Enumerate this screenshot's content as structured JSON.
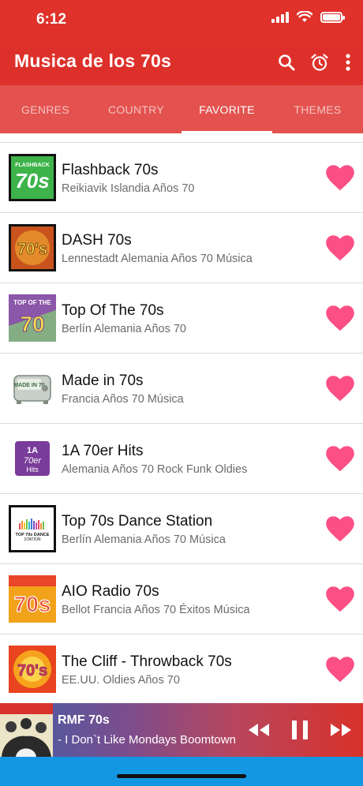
{
  "status_bar": {
    "time": "6:12"
  },
  "header": {
    "title": "Musica de los 70s",
    "icons": [
      "search-icon",
      "alarm-icon",
      "more-vert-icon"
    ]
  },
  "tabs": [
    {
      "label": "GENRES",
      "active": false
    },
    {
      "label": "COUNTRY",
      "active": false
    },
    {
      "label": "FAVORITE",
      "active": true
    },
    {
      "label": "THEMES",
      "active": false
    }
  ],
  "stations": [
    {
      "name": "Flashback 70s",
      "desc": "Reikiavik Islandia Años 70",
      "logo_text": "FLASHBACK 70s",
      "favorite": true
    },
    {
      "name": "DASH 70s",
      "desc": "Lennestadt Alemania Años 70 Música",
      "logo_text": "70's",
      "favorite": true
    },
    {
      "name": "Top Of The 70s",
      "desc": "Berlín Alemania Años 70",
      "logo_text": "TOP OF THE 70",
      "favorite": true
    },
    {
      "name": "Made in 70s",
      "desc": "Francia Años 70 Música",
      "logo_text": "MADE IN 70",
      "favorite": true
    },
    {
      "name": "1A 70er Hits",
      "desc": "Alemania Años 70 Rock Funk Oldies",
      "logo_text": "1A 70er Hits",
      "favorite": true
    },
    {
      "name": "Top 70s Dance Station",
      "desc": "Berlín Alemania Años 70 Música",
      "logo_text": "TOP 70s DANCE STATION",
      "favorite": true
    },
    {
      "name": "AIO Radio 70s",
      "desc": "Bellot Francia Años 70 Éxitos Música",
      "logo_text": "70s",
      "favorite": true
    },
    {
      "name": "The Cliff - Throwback 70s",
      "desc": "EE.UU. Oldies Años 70",
      "logo_text": "70's",
      "favorite": true
    }
  ],
  "player": {
    "station": "RMF 70s",
    "track": "- I Don`t Like Mondays   Boomtown Rats",
    "controls": [
      "rewind-icon",
      "pause-icon",
      "fast-forward-icon"
    ]
  },
  "colors": {
    "header_red": "#dc2f2a",
    "tab_bar": "#e3524e",
    "heart_pink": "#fb4f85",
    "bottom_blue": "#1497e3"
  }
}
